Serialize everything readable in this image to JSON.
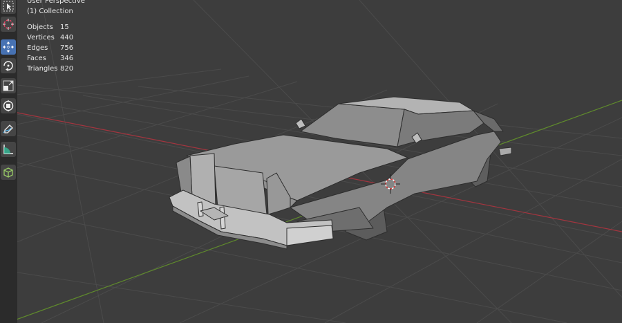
{
  "viewport": {
    "view_name": "User Perspective",
    "collection": "(1) Collection"
  },
  "stats": [
    {
      "label": "Objects",
      "value": "15"
    },
    {
      "label": "Vertices",
      "value": "440"
    },
    {
      "label": "Edges",
      "value": "756"
    },
    {
      "label": "Faces",
      "value": "346"
    },
    {
      "label": "Triangles",
      "value": "820"
    }
  ],
  "tools": [
    {
      "name": "select-box-tool",
      "icon": "cursor-select-icon",
      "active": false
    },
    {
      "name": "cursor-tool",
      "icon": "3d-cursor-icon",
      "active": false
    },
    {
      "name": "move-tool",
      "icon": "move-arrows-icon",
      "active": true
    },
    {
      "name": "rotate-tool",
      "icon": "rotate-icon",
      "active": false
    },
    {
      "name": "scale-tool",
      "icon": "scale-icon",
      "active": false
    },
    {
      "name": "transform-tool",
      "icon": "transform-icon",
      "active": false
    },
    {
      "name": "annotate-tool",
      "icon": "annotate-pencil-icon",
      "active": false
    },
    {
      "name": "measure-tool",
      "icon": "measure-ruler-icon",
      "active": false
    },
    {
      "name": "add-cube-tool",
      "icon": "add-cube-icon",
      "active": false
    }
  ],
  "colors": {
    "background": "#3d3d3d",
    "grid": "#4a4a4a",
    "x_axis": "#a3353f",
    "y_axis": "#5f8a2c",
    "active_tool": "#4772b3",
    "toolbar": "#2b2b2b"
  }
}
